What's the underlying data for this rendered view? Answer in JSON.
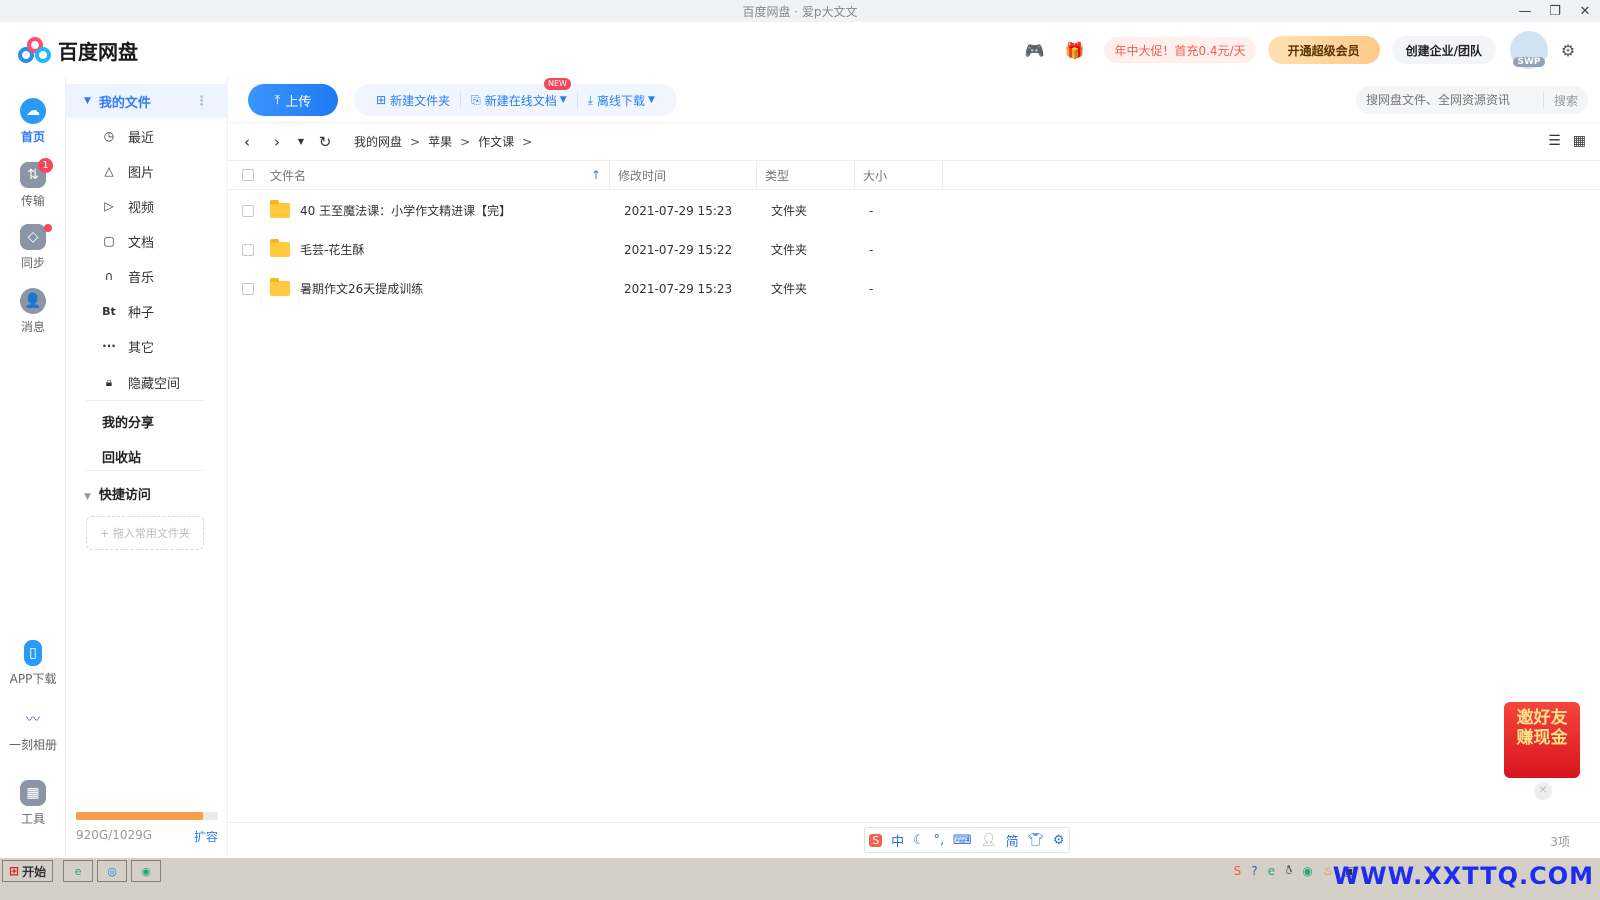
{
  "window": {
    "title": "百度网盘 · 爱p大文文"
  },
  "header": {
    "logo_text": "百度网盘",
    "promo": "年中大促！首充0.4元/天",
    "vip_button": "开通超级会员",
    "team_button": "创建企业/团队",
    "avatar_tag": "SWP"
  },
  "rail": {
    "home": "首页",
    "transfer": "传输",
    "transfer_badge": "1",
    "sync": "同步",
    "messages": "消息",
    "app_download": "APP下载",
    "album": "一刻相册",
    "tools": "工具"
  },
  "sidebar": {
    "my_files": "我的文件",
    "items": [
      {
        "icon": "clock-icon",
        "label": "最近"
      },
      {
        "icon": "image-icon",
        "label": "图片"
      },
      {
        "icon": "play-icon",
        "label": "视频"
      },
      {
        "icon": "doc-icon",
        "label": "文档"
      },
      {
        "icon": "headphones-icon",
        "label": "音乐"
      },
      {
        "icon": "bt-icon",
        "label": "种子",
        "glyph": "Bt"
      },
      {
        "icon": "more-icon",
        "label": "其它",
        "glyph": "···"
      },
      {
        "icon": "lock-icon",
        "label": "隐藏空间"
      }
    ],
    "my_share": "我的分享",
    "recycle": "回收站",
    "quick_access": "快捷访问",
    "dropzone": "+ 拖入常用文件夹",
    "storage_text": "920G/1029G",
    "storage_used": 920,
    "storage_total": 1029,
    "expand": "扩容"
  },
  "toolbar": {
    "upload": "上传",
    "new_folder": "新建文件夹",
    "new_online_doc": "新建在线文档",
    "new_badge": "NEW",
    "offline_download": "离线下载",
    "search_placeholder": "搜网盘文件、全网资源资讯",
    "search_button": "搜索"
  },
  "breadcrumb": [
    "我的网盘",
    "苹果",
    "作文课"
  ],
  "table": {
    "columns": [
      "文件名",
      "修改时间",
      "类型",
      "大小"
    ],
    "rows": [
      {
        "name": "40 王至魔法课：小学作文精进课【完】",
        "modified": "2021-07-29 15:23",
        "type": "文件夹",
        "size": "-"
      },
      {
        "name": "毛芸-花生酥",
        "modified": "2021-07-29 15:22",
        "type": "文件夹",
        "size": "-"
      },
      {
        "name": "暑期作文26天提成训练",
        "modified": "2021-07-29 15:23",
        "type": "文件夹",
        "size": "-"
      }
    ]
  },
  "status": {
    "count": "3项"
  },
  "ime": [
    "中",
    "简"
  ],
  "invite": {
    "line1": "邀好友",
    "line2": "赚现金"
  },
  "taskbar": {
    "start": "开始",
    "watermark": "WWW.XXTTQ.COM"
  },
  "colors": {
    "accent": "#2b7df7",
    "promo": "#f0604d",
    "folder": "#ffc83d",
    "storage": "#f99d4b"
  }
}
